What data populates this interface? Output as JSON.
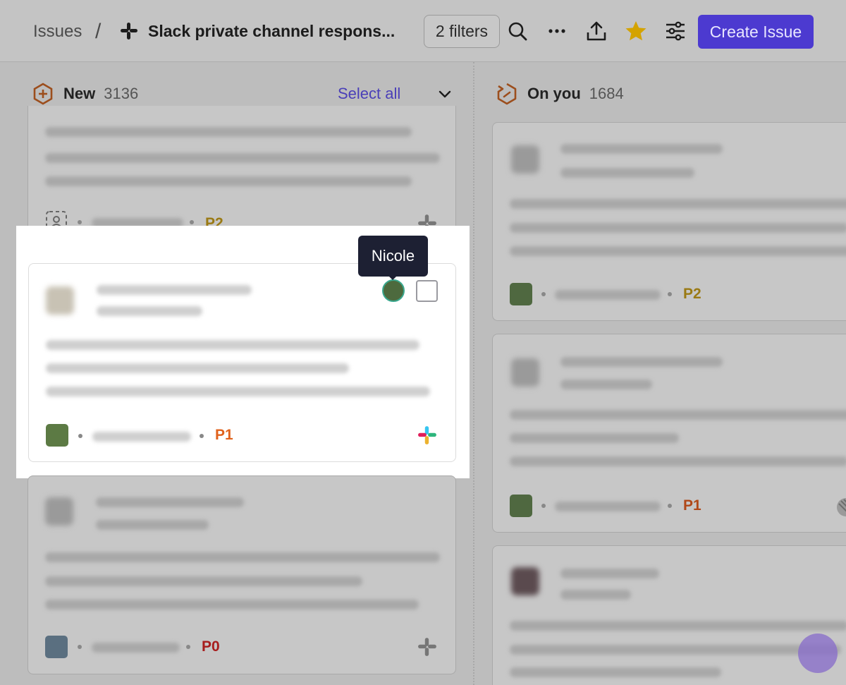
{
  "header": {
    "breadcrumb_root": "Issues",
    "breadcrumb_separator": "/",
    "view_title": "Slack private channel respons...",
    "filters_label": "2 filters",
    "create_label": "Create Issue",
    "icons": [
      "search-icon",
      "more-icon",
      "export-icon",
      "star-icon",
      "settings-sliders-icon"
    ],
    "star_color": "#d4a300",
    "accent": "#4c3ad0"
  },
  "columns": [
    {
      "title": "New",
      "count": "3136",
      "select_all": "Select all",
      "icon": "new-hexagon-icon"
    },
    {
      "title": "On you",
      "count": "1684",
      "icon": "on-you-icon"
    }
  ],
  "cards_new": [
    {
      "priority": "P2",
      "priority_color": "#9a7a14"
    },
    {
      "priority": "P1",
      "priority_color": "#e0621c",
      "assignee_tooltip": "Nicole"
    },
    {
      "priority": "P0",
      "priority_color": "#a71d1d"
    }
  ],
  "cards_on_you": [
    {
      "priority": "P2",
      "priority_color": "#9a7a14"
    },
    {
      "priority": "P1",
      "priority_color": "#b04818"
    },
    {
      "priority": ""
    }
  ]
}
